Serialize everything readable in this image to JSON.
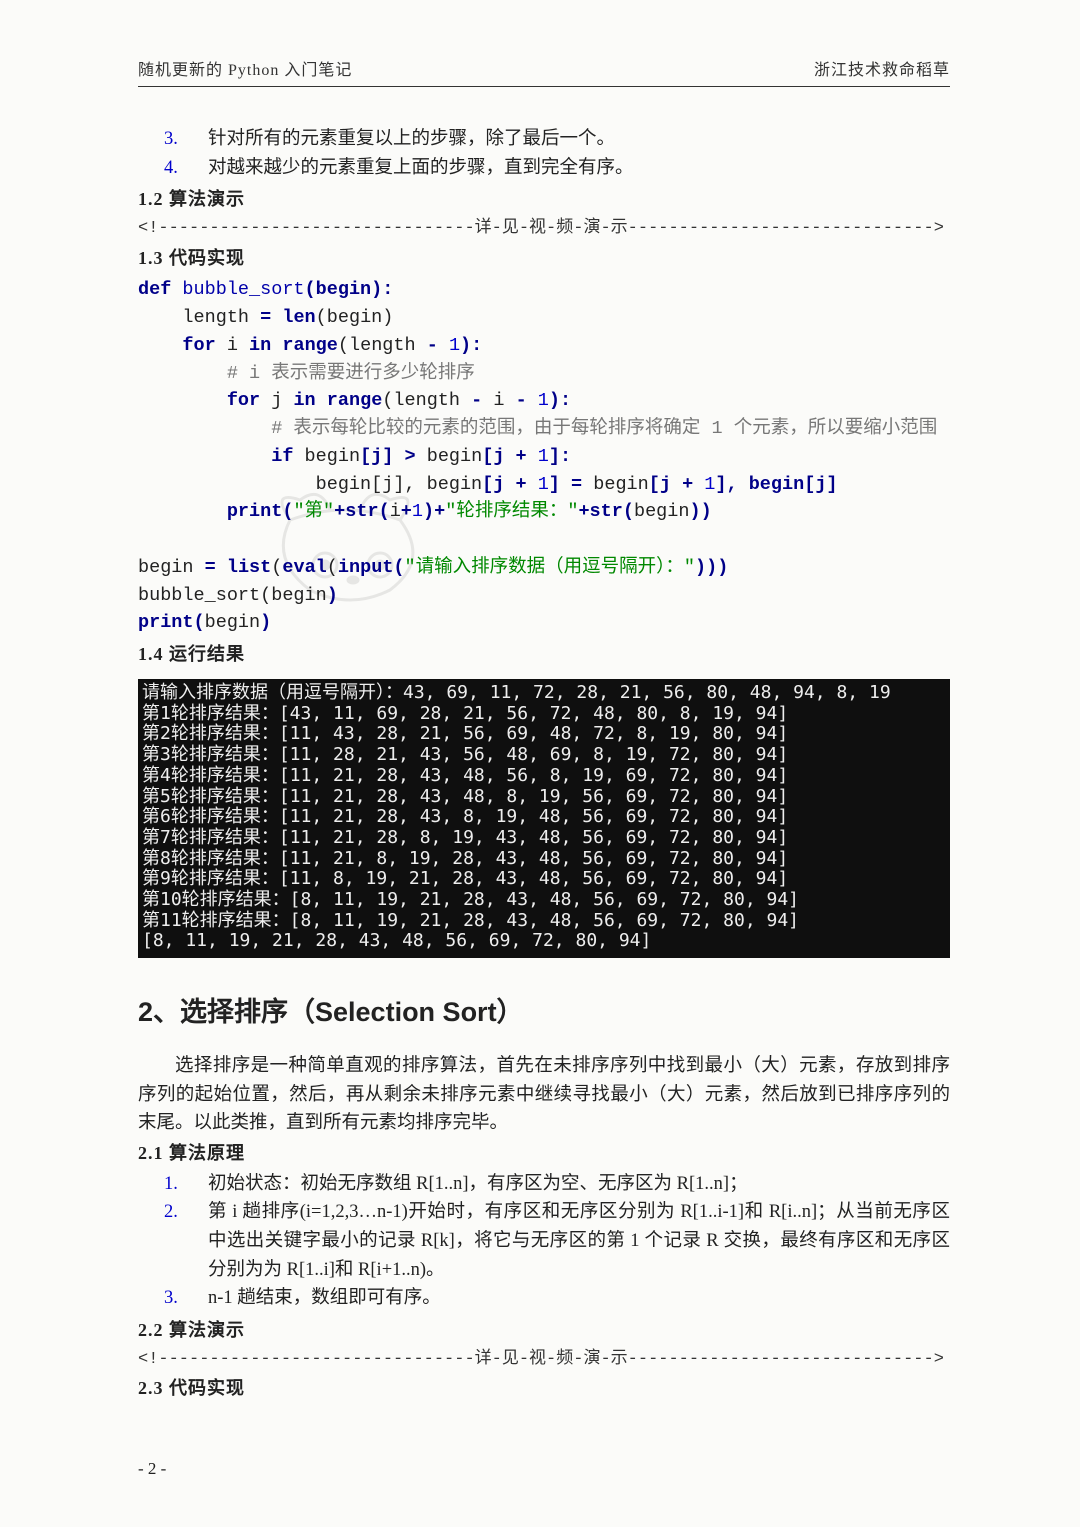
{
  "header": {
    "left": "随机更新的 Python 入门笔记",
    "right": "浙江技术救命稻草"
  },
  "bubble_steps": [
    {
      "n": "3.",
      "t": "针对所有的元素重复以上的步骤，除了最后一个。"
    },
    {
      "n": "4.",
      "t": "对越来越少的元素重复上面的步骤，直到完全有序。"
    }
  ],
  "subs": {
    "s12": "1.2 算法演示",
    "s13": "1.3 代码实现",
    "s14": "1.4 运行结果",
    "s21": "2.1 算法原理",
    "s22": "2.2 算法演示",
    "s23": "2.3 代码实现"
  },
  "divider": "<!-------------------------------详-见-视-频-演-示------------------------------>",
  "code": {
    "l1_def": "def",
    "l1_fn": " bubble_sort",
    "l1_paren": "(begin):",
    "l2a": "    length ",
    "l2_eq": "= ",
    "l2b": "len",
    "l2c": "(begin)",
    "l3a": "    ",
    "l3_for": "for",
    "l3b": " i ",
    "l3_in": "in",
    "l3c": " ",
    "l3_range": "range",
    "l3d": "(length ",
    "l3_minus": "- ",
    "l3_num": "1",
    "l3e": "):",
    "l4": "        # i 表示需要进行多少轮排序",
    "l5a": "        ",
    "l5_for": "for",
    "l5b": " j ",
    "l5_in": "in",
    "l5c": " ",
    "l5_range": "range",
    "l5d": "(length ",
    "l5_minus": "- ",
    "l5e": "i ",
    "l5_minus2": "- ",
    "l5_num": "1",
    "l5f": "):",
    "l6": "            # 表示每轮比较的元素的范围，由于每轮排序将确定 1 个元素，所以要缩小范围",
    "l7a": "            ",
    "l7_if": "if",
    "l7b": " begin",
    "l7c": "[j] ",
    "l7_gt": "> ",
    "l7d": "begin",
    "l7e": "[j ",
    "l7_plus": "+ ",
    "l7_num": "1",
    "l7f": "]:",
    "l8": "                begin[j], begin",
    "l8b": "[j ",
    "l8_plus": "+ ",
    "l8_num": "1",
    "l8c": "] ",
    "l8_eq": "= ",
    "l8d": "begin",
    "l8e": "[j ",
    "l8_plus2": "+ ",
    "l8_num2": "1",
    "l8f": "], begin",
    "l8g": "[j]",
    "l9a": "        ",
    "l9_print": "print(",
    "l9_str1": "\"第\"",
    "l9_plus1": "+str(",
    "l9_i": "i",
    "l9_plus2": "+",
    "l9_num": "1",
    "l9_close": ")+",
    "l9_str2": "\"轮排序结果：\"",
    "l9_plus3": "+str(",
    "l9_begin": "begin",
    "l9_end": "))",
    "blank": "",
    "l10a": "begin ",
    "l10_eq": "= ",
    "l10_list": "list",
    "l10b": "(",
    "l10_eval": "eval",
    "l10c": "(",
    "l10_input": "input(",
    "l10_str": "\"请输入排序数据（用逗号隔开）：\"",
    "l10d": ")))",
    "l11": "bubble_sort",
    "l11b": "(begin",
    "l11c": ")",
    "l12_print": "print(",
    "l12b": "begin",
    "l12c": ")"
  },
  "terminal_lines": [
    "请输入排序数据（用逗号隔开）：43, 69, 11, 72, 28, 21, 56, 80, 48, 94, 8, 19",
    "第1轮排序结果：[43, 11, 69, 28, 21, 56, 72, 48, 80, 8, 19, 94]",
    "第2轮排序结果：[11, 43, 28, 21, 56, 69, 48, 72, 8, 19, 80, 94]",
    "第3轮排序结果：[11, 28, 21, 43, 56, 48, 69, 8, 19, 72, 80, 94]",
    "第4轮排序结果：[11, 21, 28, 43, 48, 56, 8, 19, 69, 72, 80, 94]",
    "第5轮排序结果：[11, 21, 28, 43, 48, 8, 19, 56, 69, 72, 80, 94]",
    "第6轮排序结果：[11, 21, 28, 43, 8, 19, 48, 56, 69, 72, 80, 94]",
    "第7轮排序结果：[11, 21, 28, 8, 19, 43, 48, 56, 69, 72, 80, 94]",
    "第8轮排序结果：[11, 21, 8, 19, 28, 43, 48, 56, 69, 72, 80, 94]",
    "第9轮排序结果：[11, 8, 19, 21, 28, 43, 48, 56, 69, 72, 80, 94]",
    "第10轮排序结果：[8, 11, 19, 21, 28, 43, 48, 56, 69, 72, 80, 94]",
    "第11轮排序结果：[8, 11, 19, 21, 28, 43, 48, 56, 69, 72, 80, 94]",
    "[8, 11, 19, 21, 28, 43, 48, 56, 69, 72, 80, 94]"
  ],
  "section2": {
    "title": "2、选择排序（Selection Sort）",
    "intro": "选择排序是一种简单直观的排序算法，首先在未排序序列中找到最小（大）元素，存放到排序序列的起始位置，然后，再从剩余未排序元素中继续寻找最小（大）元素，然后放到已排序序列的末尾。以此类推，直到所有元素均排序完毕。",
    "steps": [
      {
        "n": "1.",
        "t": "初始状态：初始无序数组 R[1..n]，有序区为空、无序区为 R[1..n]；"
      },
      {
        "n": "2.",
        "t": "第 i 趟排序(i=1,2,3…n-1)开始时，有序区和无序区分别为 R[1..i-1]和 R[i..n]；从当前无序区中选出关键字最小的记录 R[k]，将它与无序区的第 1 个记录 R 交换，最终有序区和无序区分别为为 R[1..i]和 R[i+1..n)。"
      },
      {
        "n": "3.",
        "t": "n-1 趟结束，数组即可有序。"
      }
    ]
  },
  "footer": "- 2 -"
}
